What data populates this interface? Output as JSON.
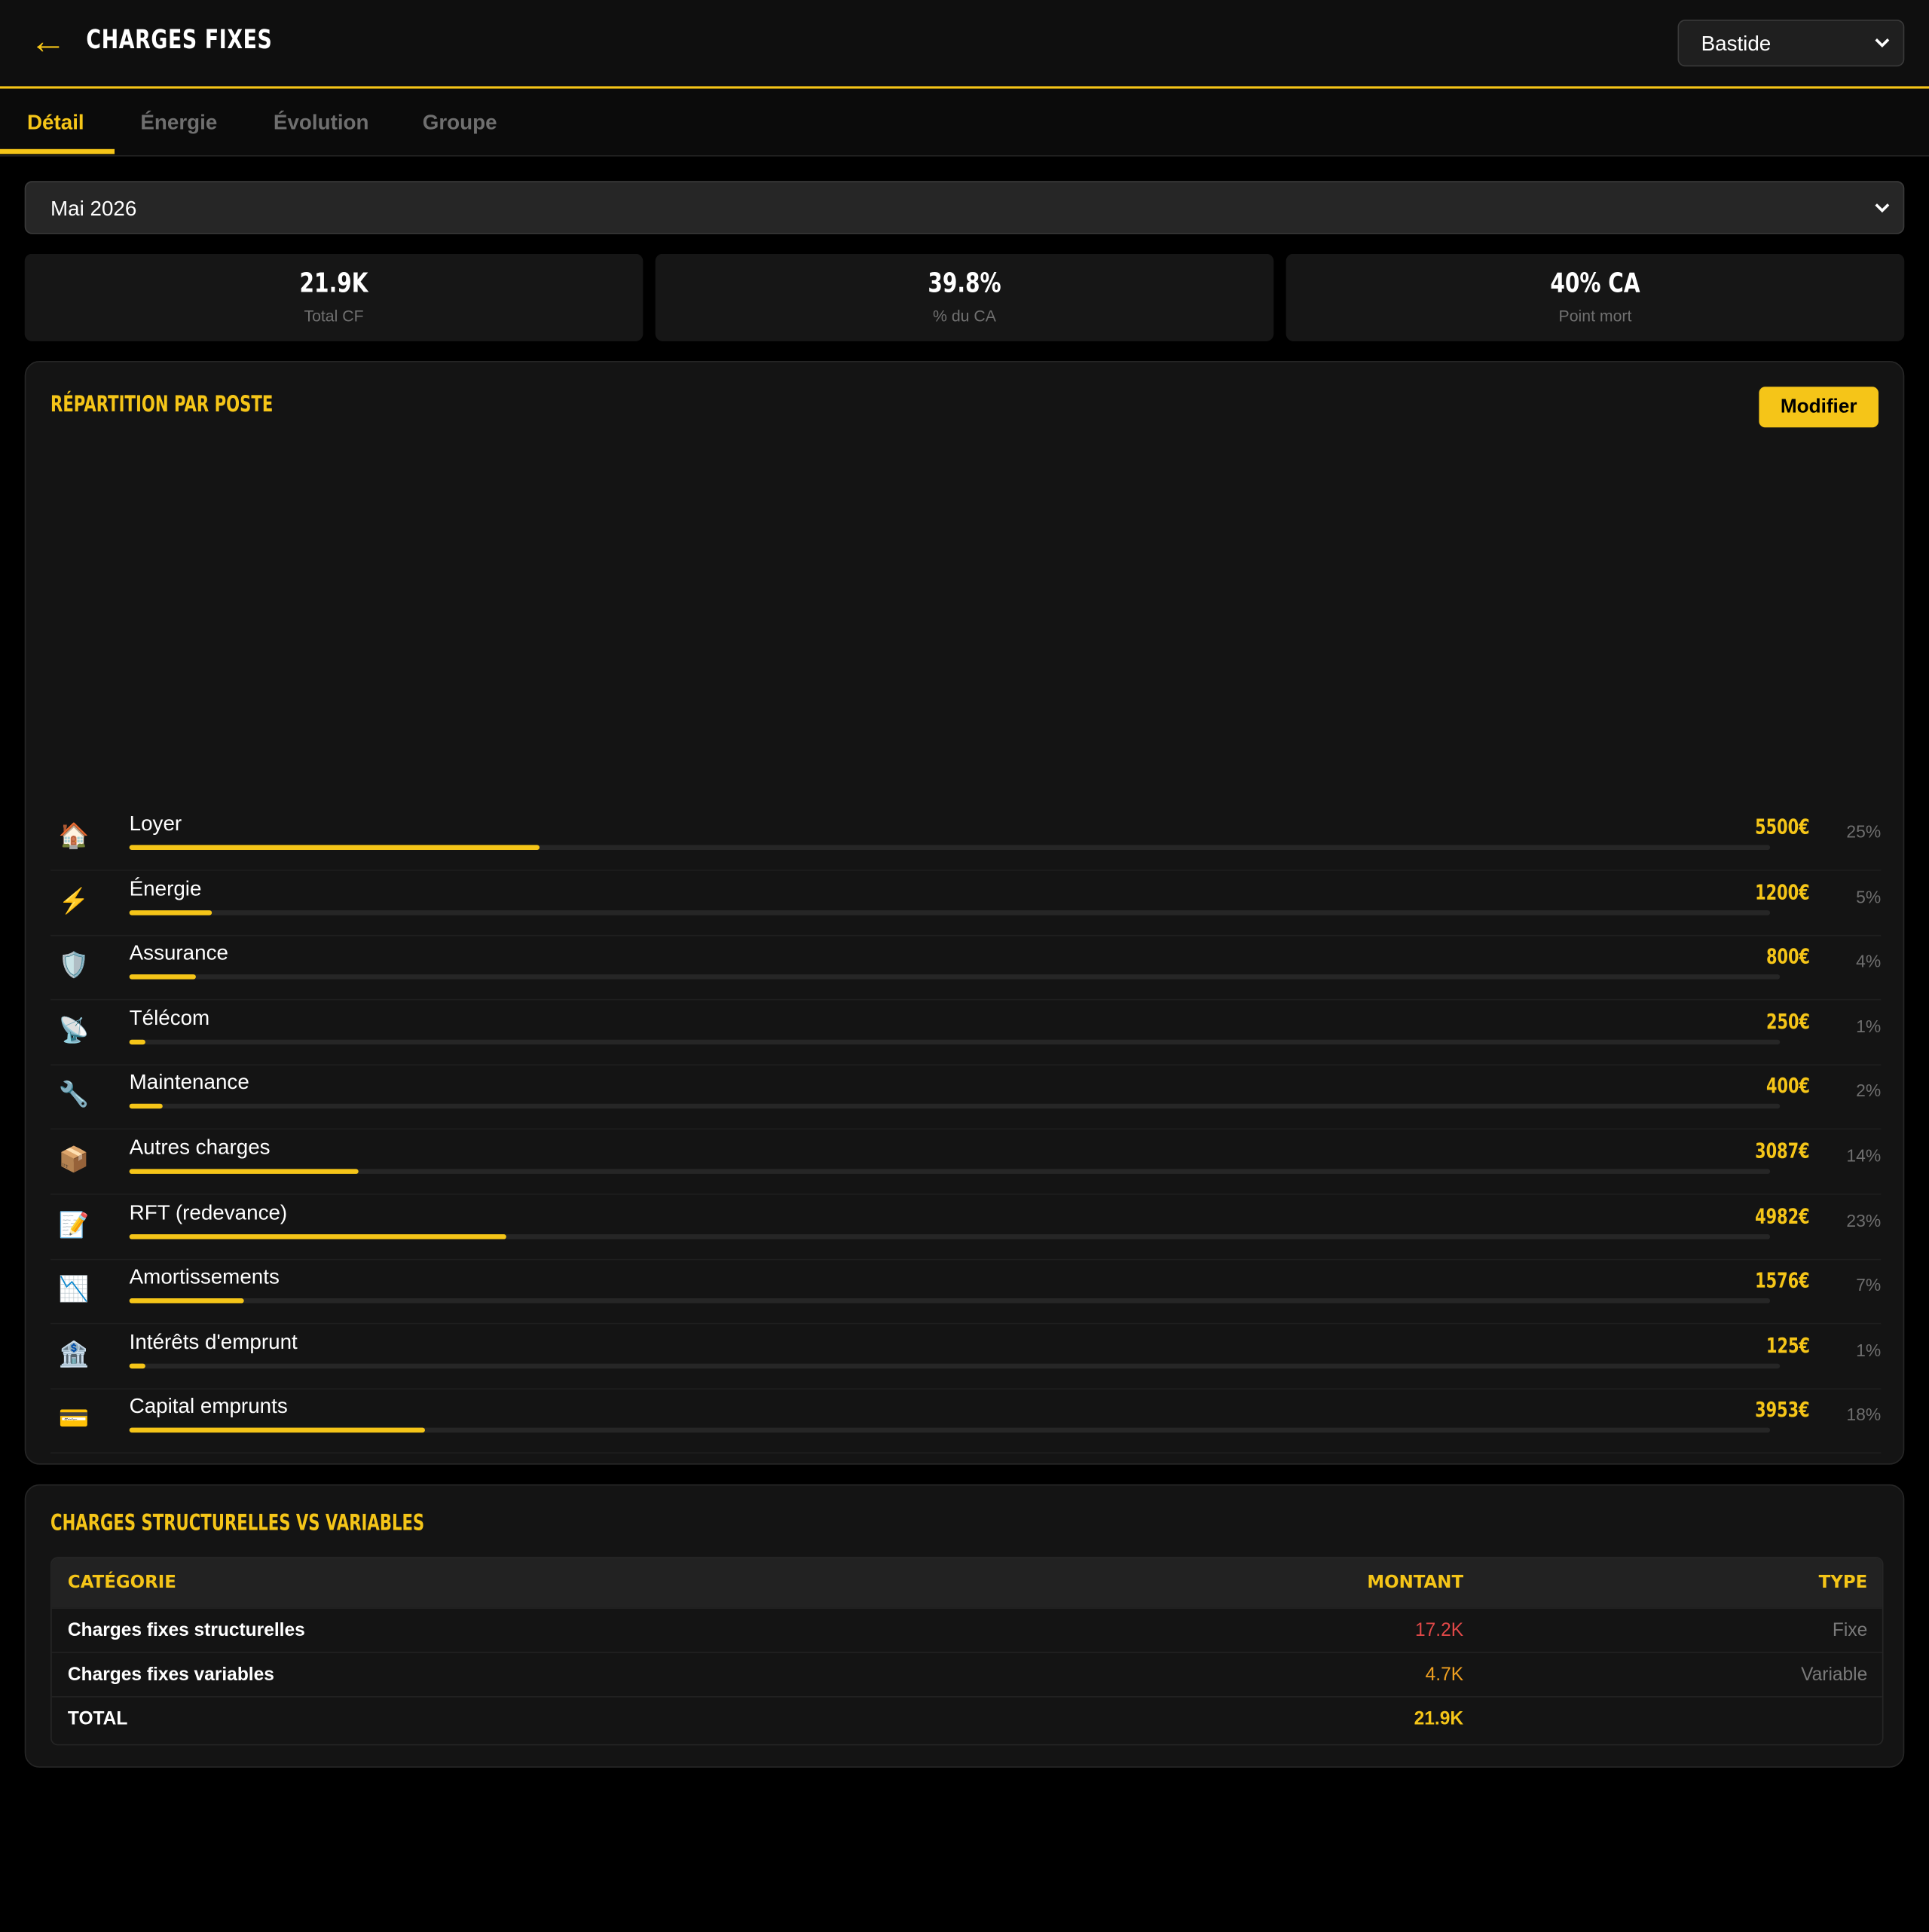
{
  "header": {
    "back_icon": "←",
    "title": "CHARGES FIXES",
    "site_selected": "Bastide"
  },
  "tabs": [
    {
      "label": "Détail",
      "active": true
    },
    {
      "label": "Énergie",
      "active": false
    },
    {
      "label": "Évolution",
      "active": false
    },
    {
      "label": "Groupe",
      "active": false
    }
  ],
  "period": {
    "selected": "Mai 2026"
  },
  "kpis": [
    {
      "value": "21.9K",
      "label": "Total CF"
    },
    {
      "value": "39.8%",
      "label": "% du CA"
    },
    {
      "value": "40% CA",
      "label": "Point mort"
    }
  ],
  "breakdown": {
    "title": "RÉPARTITION PAR POSTE",
    "modify_label": "Modifier",
    "items": [
      {
        "icon": "🏠",
        "icon_name": "house-icon",
        "name": "Loyer",
        "amount": "5500€",
        "pct": "25%",
        "share": 25
      },
      {
        "icon": "⚡",
        "icon_name": "lightning-icon",
        "name": "Énergie",
        "amount": "1200€",
        "pct": "5%",
        "share": 5
      },
      {
        "icon": "🛡️",
        "icon_name": "shield-icon",
        "name": "Assurance",
        "amount": "800€",
        "pct": "4%",
        "share": 4
      },
      {
        "icon": "📡",
        "icon_name": "satellite-dish-icon",
        "name": "Télécom",
        "amount": "250€",
        "pct": "1%",
        "share": 1
      },
      {
        "icon": "🔧",
        "icon_name": "wrench-icon",
        "name": "Maintenance",
        "amount": "400€",
        "pct": "2%",
        "share": 2
      },
      {
        "icon": "📦",
        "icon_name": "package-icon",
        "name": "Autres charges",
        "amount": "3087€",
        "pct": "14%",
        "share": 14
      },
      {
        "icon": "📝",
        "icon_name": "memo-icon",
        "name": "RFT (redevance)",
        "amount": "4982€",
        "pct": "23%",
        "share": 23
      },
      {
        "icon": "📉",
        "icon_name": "chart-decreasing-icon",
        "name": "Amortissements",
        "amount": "1576€",
        "pct": "7%",
        "share": 7
      },
      {
        "icon": "🏦",
        "icon_name": "bank-icon",
        "name": "Intérêts d'emprunt",
        "amount": "125€",
        "pct": "1%",
        "share": 1
      },
      {
        "icon": "💳",
        "icon_name": "credit-card-icon",
        "name": "Capital emprunts",
        "amount": "3953€",
        "pct": "18%",
        "share": 18
      }
    ]
  },
  "structure": {
    "title": "CHARGES STRUCTURELLES VS VARIABLES",
    "columns": [
      "CATÉGORIE",
      "MONTANT",
      "TYPE"
    ],
    "rows": [
      {
        "category": "Charges fixes structurelles",
        "amount": "17.2K",
        "type": "Fixe",
        "amount_color": "#e04848"
      },
      {
        "category": "Charges fixes variables",
        "amount": "4.7K",
        "type": "Variable",
        "amount_color": "#f0a020"
      },
      {
        "category": "TOTAL",
        "amount": "21.9K",
        "type": "",
        "amount_color": "#f5c518"
      }
    ]
  },
  "colors": {
    "accent": "#f5c518",
    "background": "#000000",
    "panel": "#141414"
  }
}
